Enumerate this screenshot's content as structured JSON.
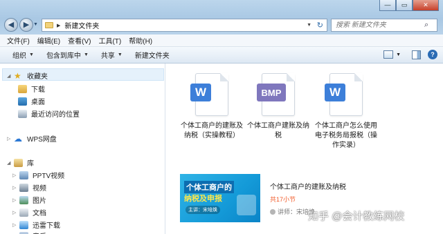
{
  "window": {
    "minimize": "—",
    "maximize": "▭",
    "close": "✕"
  },
  "nav": {
    "back": "◀",
    "forward": "▶"
  },
  "address": {
    "path": "新建文件夹"
  },
  "search": {
    "placeholder": "搜索 新建文件夹"
  },
  "menubar": [
    "文件(F)",
    "编辑(E)",
    "查看(V)",
    "工具(T)",
    "帮助(H)"
  ],
  "toolbar": {
    "organize": "组织",
    "include_library": "包含到库中",
    "share": "共享",
    "new_folder": "新建文件夹"
  },
  "navpane": {
    "favorites": "收藏夹",
    "favorites_items": [
      "下载",
      "桌面",
      "最近访问的位置"
    ],
    "wps_cloud": "WPS网盘",
    "libraries": "库",
    "library_items": [
      "PPTV视频",
      "视频",
      "图片",
      "文档",
      "迅雷下载",
      "音乐"
    ]
  },
  "files": [
    {
      "badge": "W",
      "name": "个体工商户的建账及纳税（实操教程）"
    },
    {
      "badge": "BMP",
      "name": "个体工商户建账及纳税"
    },
    {
      "badge": "W",
      "name": "个体工商户怎么使用电子税务局报税（操作实录）"
    }
  ],
  "ad": {
    "thumb_line1": "个体工商户的",
    "thumb_line2": "纳税及申报",
    "thumb_line3": "主讲：宋培焕",
    "title": "个体工商户的建账及纳税",
    "lessons": "共17小节",
    "teacher": "讲师：宋培焕"
  },
  "watermark": "知乎 @会计教练网校",
  "colors": {
    "title_bar": "#a9c8e4",
    "toolbar": "#dde8f3",
    "word_badge": "#3d7fd9",
    "bmp_badge": "#7f77bd",
    "selection": "#e5f1fb",
    "lessons_text": "#f25b2a"
  }
}
